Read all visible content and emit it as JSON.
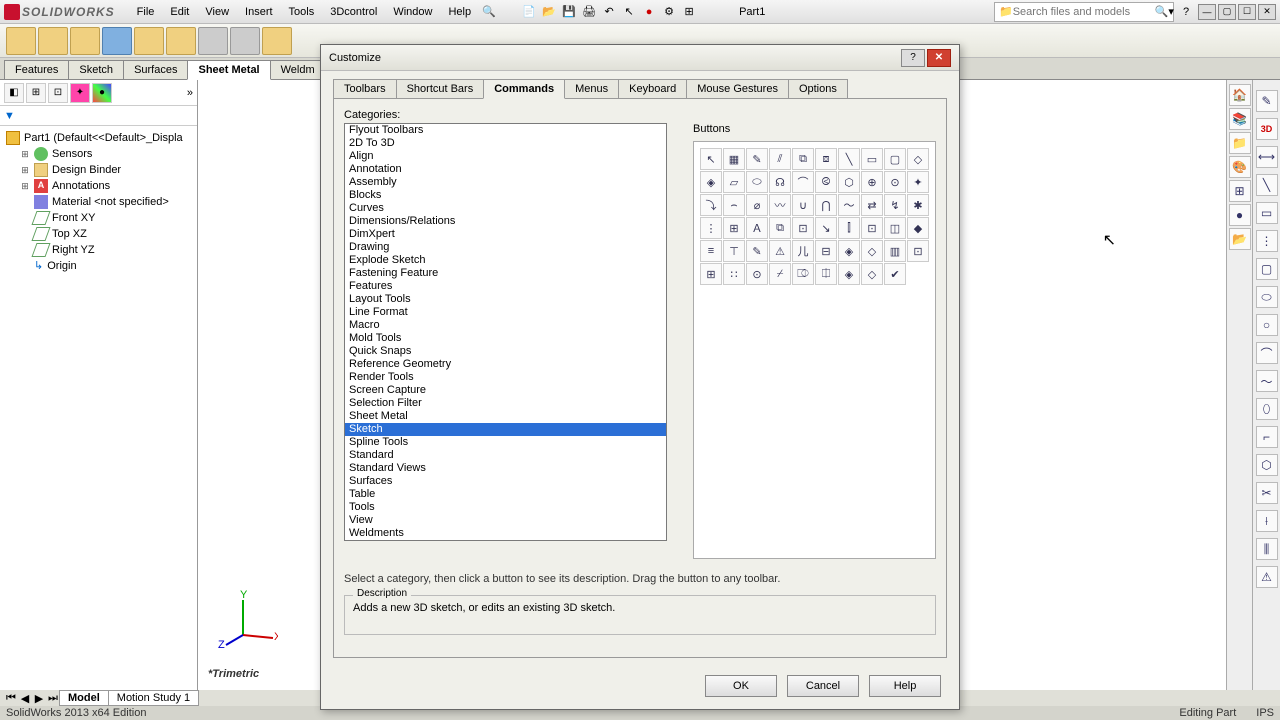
{
  "app": {
    "logo_text": "SOLIDWORKS",
    "doc_name": "Part1"
  },
  "menu": [
    "File",
    "Edit",
    "View",
    "Insert",
    "Tools",
    "3Dcontrol",
    "Window",
    "Help"
  ],
  "search": {
    "placeholder": "Search files and models"
  },
  "cm_tabs": [
    "Features",
    "Sketch",
    "Surfaces",
    "Sheet Metal",
    "Weldm"
  ],
  "cm_active": 3,
  "tree": {
    "root": "Part1 (Default<<Default>_Displa",
    "items": [
      "Sensors",
      "Design Binder",
      "Annotations",
      "Material <not specified>",
      "Front XY",
      "Top XZ",
      "Right YZ",
      "Origin"
    ]
  },
  "triad_label": "*Trimetric",
  "bottom_tabs": [
    "Model",
    "Motion Study 1"
  ],
  "status": {
    "left": "SolidWorks 2013 x64 Edition",
    "right1": "Editing Part",
    "right2": "IPS"
  },
  "dialog": {
    "title": "Customize",
    "tabs": [
      "Toolbars",
      "Shortcut Bars",
      "Commands",
      "Menus",
      "Keyboard",
      "Mouse Gestures",
      "Options"
    ],
    "active_tab": 2,
    "cat_label": "Categories:",
    "categories": [
      "Flyout Toolbars",
      "2D To 3D",
      "Align",
      "Annotation",
      "Assembly",
      "Blocks",
      "Curves",
      "Dimensions/Relations",
      "DimXpert",
      "Drawing",
      "Explode Sketch",
      "Fastening Feature",
      "Features",
      "Layout Tools",
      "Line Format",
      "Macro",
      "Mold Tools",
      "Quick Snaps",
      "Reference Geometry",
      "Render Tools",
      "Screen Capture",
      "Selection Filter",
      "Sheet Metal",
      "Sketch",
      "Spline Tools",
      "Standard",
      "Standard Views",
      "Surfaces",
      "Table",
      "Tools",
      "View",
      "Weldments"
    ],
    "selected_cat": 23,
    "btn_label": "Buttons",
    "hint": "Select a category, then click a button to see its description. Drag the button to any toolbar.",
    "desc_label": "Description",
    "desc_text": "Adds a new 3D sketch, or edits an existing 3D sketch.",
    "ok": "OK",
    "cancel": "Cancel",
    "help": "Help"
  },
  "button_glyphs": [
    "↖",
    "▦",
    "✎",
    "⫽",
    "⧉",
    "⧈",
    "╲",
    "▭",
    "▢",
    "◇",
    "◈",
    "▱",
    "⬭",
    "☊",
    "⌒",
    "⧀",
    "⬡",
    "⊕",
    "⊙",
    "✦",
    "⤵",
    "⌢",
    "⌀",
    "〰",
    "∪",
    "⋂",
    "〜",
    "⇄",
    "↯",
    "✱",
    "⋮",
    "⊞",
    "Ａ",
    "⧉",
    "⊡",
    "↘",
    "⫿",
    "⊡",
    "◫",
    "◆",
    "≡",
    "⊤",
    "✎",
    "⚠",
    "⼉",
    "⊟",
    "◈",
    "◇",
    "▥",
    "⊡",
    "⊞",
    "∷",
    "⊙",
    "⌿",
    "⎄",
    "⎅",
    "◈",
    "◇",
    "✔"
  ]
}
